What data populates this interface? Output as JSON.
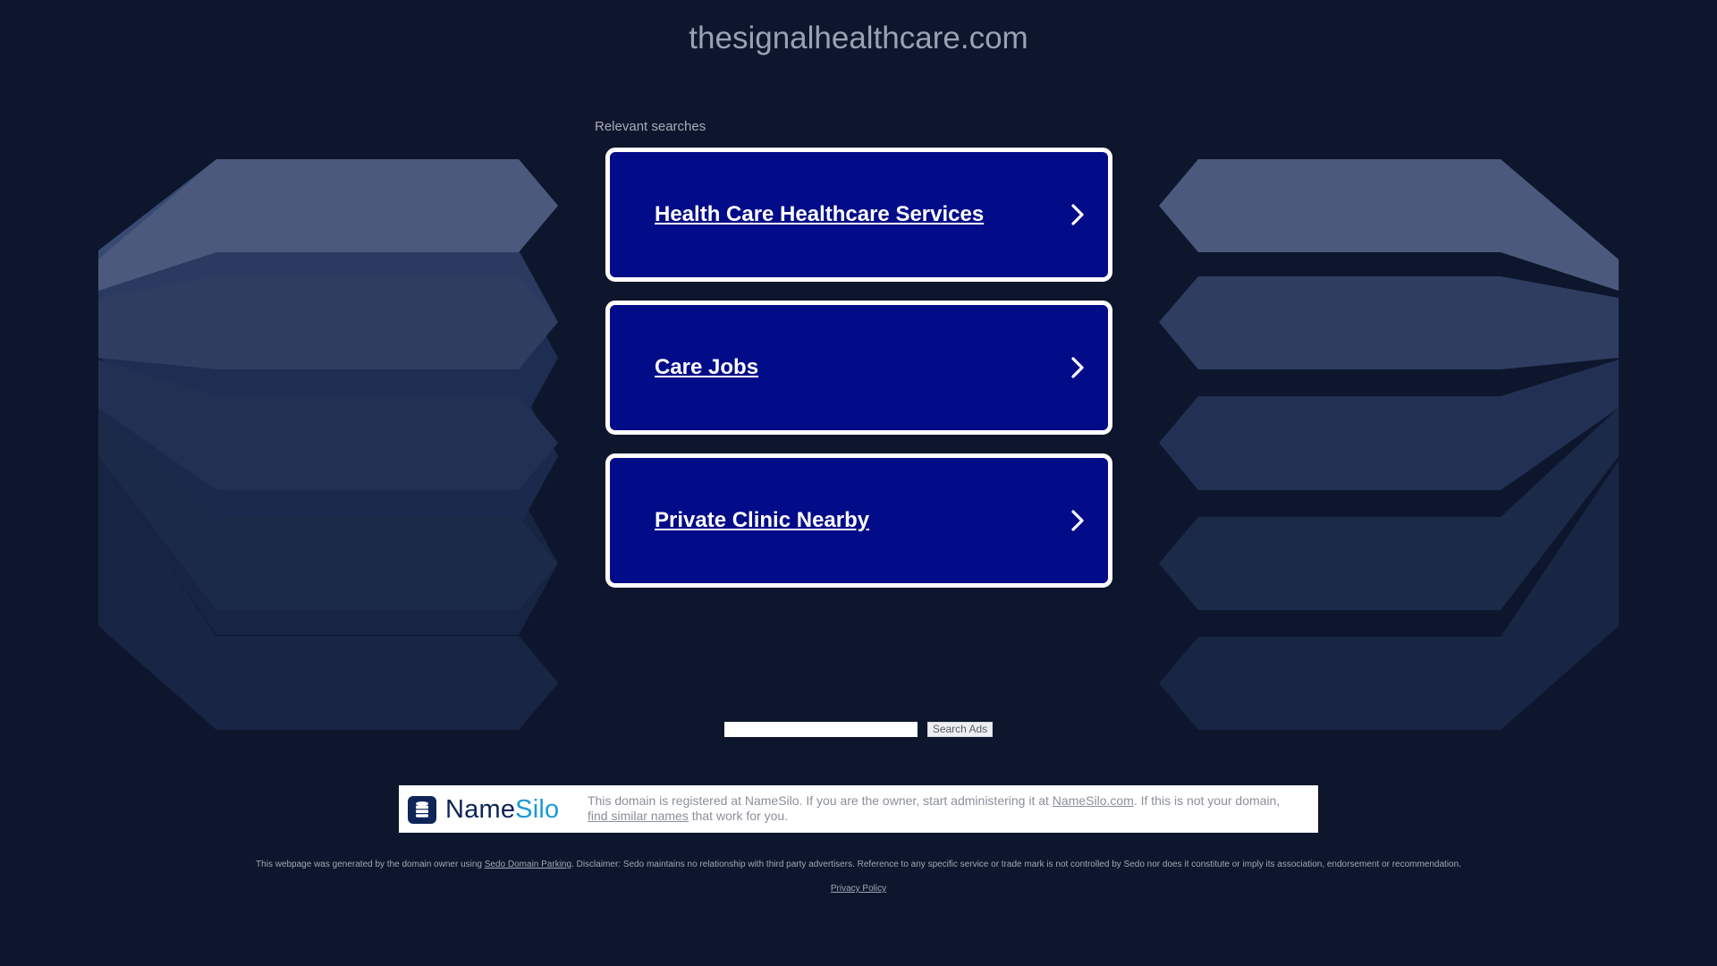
{
  "page": {
    "domain_title": "thesignalhealthcare.com"
  },
  "relevant": {
    "label": "Relevant searches",
    "results": [
      {
        "label": "Health Care Healthcare Services"
      },
      {
        "label": "Care Jobs"
      },
      {
        "label": "Private Clinic Nearby"
      }
    ]
  },
  "search": {
    "input_value": "",
    "button_label": "Search Ads"
  },
  "registrar": {
    "logo_text_name": "Name",
    "logo_text_silo": "Silo",
    "text_before_link": "This domain is registered at NameSilo. If you are the owner, start administering it at ",
    "link_namesilo": "NameSilo.com",
    "text_middle": ". If this is not your domain, ",
    "link_similar": "find similar names",
    "text_after": " that work for you."
  },
  "footer": {
    "disclaimer_before": "This webpage was generated by the domain owner using ",
    "disclaimer_link": "Sedo Domain Parking",
    "disclaimer_after": ". Disclaimer: Sedo maintains no relationship with third party advertisers. Reference to any specific service or trade mark is not controlled by Sedo nor does it constitute or imply its association, endorsement or recommendation.",
    "privacy_label": "Privacy Policy"
  },
  "colors": {
    "background": "#0e162d",
    "card_fill": "#020b88",
    "card_border": "#ffffff",
    "brand_dark": "#0d2557",
    "brand_light": "#1a9ad6"
  },
  "icons": {
    "result_arrow": "chevron-right-icon",
    "registrar_logo": "database-icon"
  }
}
